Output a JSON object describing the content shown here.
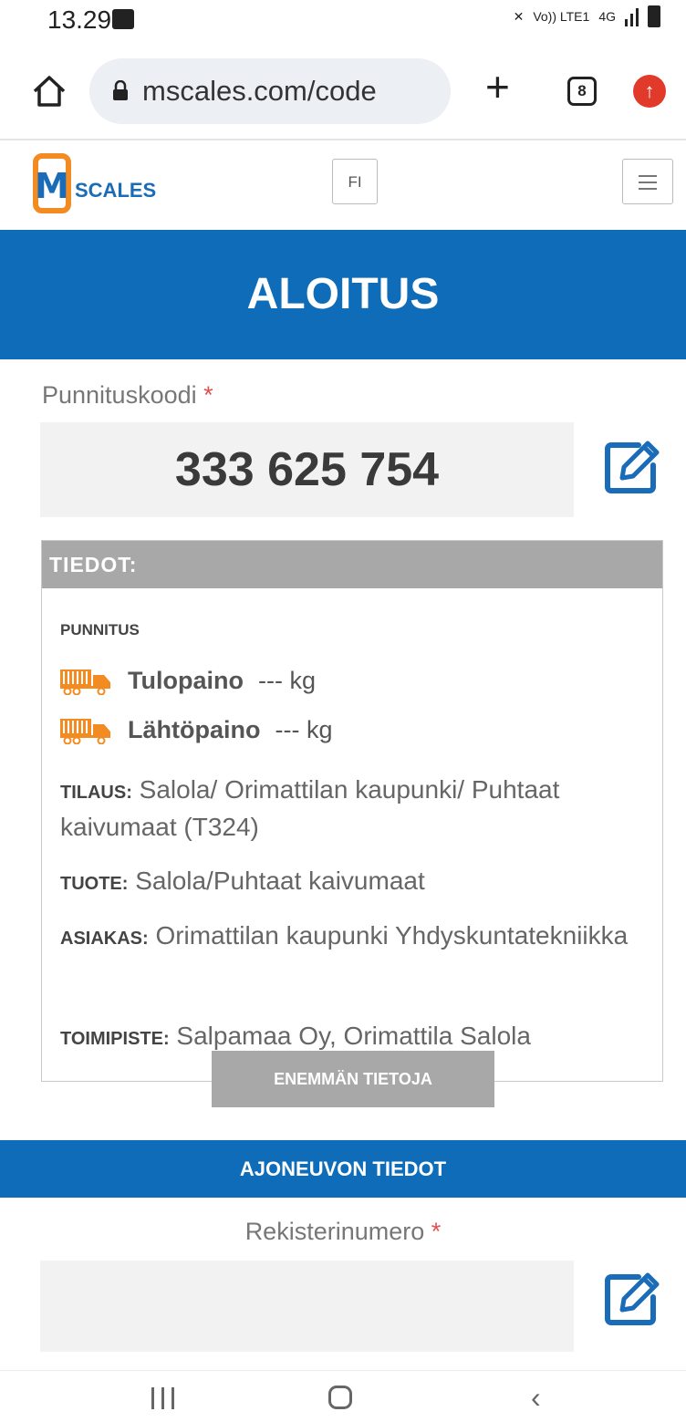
{
  "status_bar": {
    "time": "13.29",
    "network": "Vo)) LTE1",
    "network_type": "4G"
  },
  "browser": {
    "url": "mscales.com/code",
    "tab_count": "8"
  },
  "header": {
    "logo_text": "SCALES",
    "logo_m": "M",
    "language": "FI"
  },
  "hero": {
    "title": "ALOITUS"
  },
  "code": {
    "label": "Punnituskoodi",
    "required_mark": "*",
    "value": "333 625 754"
  },
  "details": {
    "heading": "TIEDOT:",
    "subheading": "PUNNITUS",
    "weights": [
      {
        "name": "Tulopaino",
        "value": "--- kg"
      },
      {
        "name": "Lähtöpaino",
        "value": "--- kg"
      }
    ],
    "info": [
      {
        "key": "TILAUS:",
        "value": "Salola/ Orimattilan kaupunki/ Puhtaat kaivumaat (T324)"
      },
      {
        "key": "TUOTE:",
        "value": "Salola/Puhtaat kaivumaat"
      },
      {
        "key": "ASIAKAS:",
        "value": "Orimattilan kaupunki Yhdyskuntatekniikka"
      },
      {
        "key": "TOIMIPISTE:",
        "value": "Salpamaa Oy, Orimattila Salola"
      }
    ],
    "more_button": "ENEMMÄN TIETOJA"
  },
  "vehicle": {
    "section_title": "AJONEUVON TIEDOT",
    "reg_label": "Rekisterinumero",
    "required_mark": "*",
    "reg_value": ""
  },
  "colors": {
    "primary": "#0e6cb9",
    "accent_orange": "#f28c22",
    "grey_header": "#a8a8a8",
    "required": "#e05050"
  },
  "icons": [
    "home-icon",
    "lock-icon",
    "plus-icon",
    "tabs-icon",
    "update-icon",
    "menu-icon",
    "edit-icon",
    "truck-icon"
  ]
}
